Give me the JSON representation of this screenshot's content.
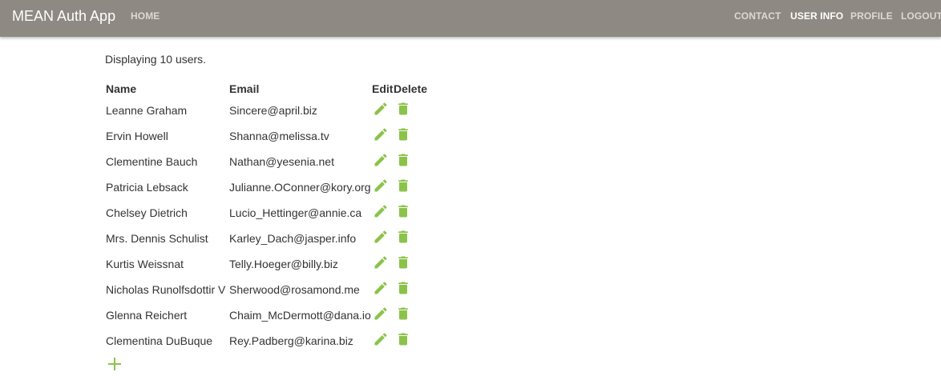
{
  "navbar": {
    "brand": "MEAN Auth App",
    "links": {
      "home": "HOME",
      "contact": "CONTACT",
      "user_info": "USER INFO",
      "profile": "PROFILE",
      "logout": "LOGOUT"
    },
    "active": "USER INFO",
    "bg_color": "#8e8983"
  },
  "summary": "Displaying 10 users.",
  "table": {
    "headers": {
      "name": "Name",
      "email": "Email",
      "edit": "Edit",
      "delete": "Delete"
    },
    "rows": [
      {
        "name": "Leanne Graham",
        "email": "Sincere@april.biz"
      },
      {
        "name": "Ervin Howell",
        "email": "Shanna@melissa.tv"
      },
      {
        "name": "Clementine Bauch",
        "email": "Nathan@yesenia.net"
      },
      {
        "name": "Patricia Lebsack",
        "email": "Julianne.OConner@kory.org"
      },
      {
        "name": "Chelsey Dietrich",
        "email": "Lucio_Hettinger@annie.ca"
      },
      {
        "name": "Mrs. Dennis Schulist",
        "email": "Karley_Dach@jasper.info"
      },
      {
        "name": "Kurtis Weissnat",
        "email": "Telly.Hoeger@billy.biz"
      },
      {
        "name": "Nicholas Runolfsdottir V",
        "email": "Sherwood@rosamond.me"
      },
      {
        "name": "Glenna Reichert",
        "email": "Chaim_McDermott@dana.io"
      },
      {
        "name": "Clementina DuBuque",
        "email": "Rey.Padberg@karina.biz"
      }
    ],
    "row_icons": [
      "pencil-icon",
      "trash-icon"
    ],
    "add_icon": "plus-icon",
    "icon_color": "#8bc34a"
  }
}
